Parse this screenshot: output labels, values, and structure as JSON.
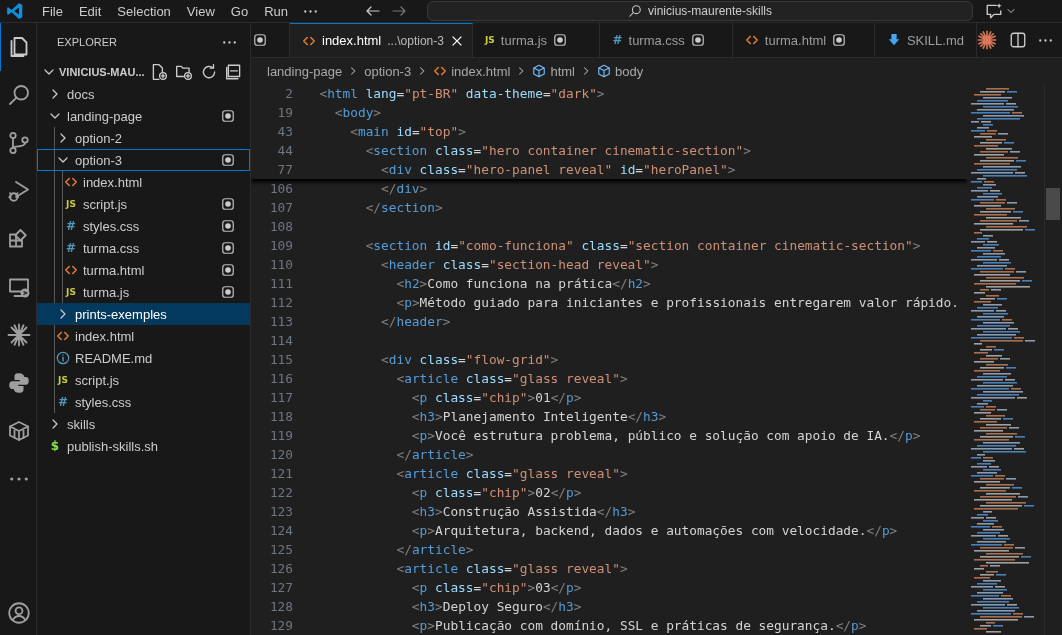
{
  "title_bar": {
    "menu": [
      "File",
      "Edit",
      "Selection",
      "View",
      "Go",
      "Run"
    ],
    "command_center": "vinicius-maurente-skills"
  },
  "activity_bar": [
    {
      "kind": "files",
      "selected": true
    },
    {
      "kind": "search",
      "selected": false
    },
    {
      "kind": "source-control",
      "selected": false
    },
    {
      "kind": "run-debug",
      "selected": false
    },
    {
      "kind": "extensions",
      "selected": false
    },
    {
      "kind": "remote",
      "selected": false
    },
    {
      "kind": "sparkle",
      "selected": false
    },
    {
      "kind": "python",
      "selected": false
    },
    {
      "kind": "containers",
      "selected": false
    },
    {
      "kind": "more",
      "selected": false
    },
    {
      "kind": "account",
      "selected": false
    }
  ],
  "sidebar": {
    "title": "EXPLORER",
    "root": "VINICIUS-MAU...",
    "items": [
      {
        "label": "docs",
        "kind": "folder",
        "expanded": false,
        "selected": false,
        "focused": false,
        "modified": false
      },
      {
        "label": "landing-page",
        "kind": "folder",
        "expanded": true,
        "selected": false,
        "focused": false,
        "modified": true,
        "children": [
          {
            "label": "option-2",
            "kind": "folder",
            "expanded": false,
            "selected": false,
            "focused": false,
            "modified": false
          },
          {
            "label": "option-3",
            "kind": "folder",
            "expanded": true,
            "selected": false,
            "focused": true,
            "modified": true,
            "children": [
              {
                "label": "index.html",
                "kind": "html",
                "selected": false,
                "focused": false,
                "modified": false
              },
              {
                "label": "script.js",
                "kind": "js",
                "badge": "JS",
                "selected": false,
                "focused": false,
                "modified": true
              },
              {
                "label": "styles.css",
                "kind": "css",
                "badge": "#",
                "selected": false,
                "focused": false,
                "modified": true
              },
              {
                "label": "turma.css",
                "kind": "css",
                "badge": "#",
                "selected": false,
                "focused": false,
                "modified": true
              },
              {
                "label": "turma.html",
                "kind": "html",
                "selected": false,
                "focused": false,
                "modified": true
              },
              {
                "label": "turma.js",
                "kind": "js",
                "badge": "JS",
                "selected": false,
                "focused": false,
                "modified": true
              }
            ]
          },
          {
            "label": "prints-exemples",
            "kind": "folder",
            "expanded": false,
            "selected": true,
            "focused": false,
            "modified": false
          },
          {
            "label": "index.html",
            "kind": "html",
            "selected": false,
            "focused": false,
            "modified": false
          },
          {
            "label": "README.md",
            "kind": "info",
            "selected": false,
            "focused": false,
            "modified": false
          },
          {
            "label": "script.js",
            "kind": "js",
            "badge": "JS",
            "selected": false,
            "focused": false,
            "modified": false
          },
          {
            "label": "styles.css",
            "kind": "css",
            "badge": "#",
            "selected": false,
            "focused": false,
            "modified": false
          }
        ]
      },
      {
        "label": "skills",
        "kind": "folder",
        "expanded": false,
        "selected": false,
        "focused": false,
        "modified": false
      },
      {
        "label": "publish-skills.sh",
        "kind": "sh",
        "badge": "$",
        "selected": false,
        "focused": false,
        "modified": false
      }
    ]
  },
  "tabs": [
    {
      "kind": "partial",
      "selected": false,
      "modified": true
    },
    {
      "label": "index.html",
      "description": "...\\option-3",
      "kind": "html",
      "selected": true,
      "modified": false
    },
    {
      "label": "turma.js",
      "kind": "js",
      "badge": "JS",
      "selected": false,
      "modified": true
    },
    {
      "label": "turma.css",
      "kind": "css",
      "badge": "#",
      "selected": false,
      "modified": true
    },
    {
      "label": "turma.html",
      "kind": "html",
      "selected": false,
      "modified": true
    },
    {
      "label": "SKILL.md",
      "kind": "md",
      "selected": false,
      "modified": false
    }
  ],
  "breadcrumb": [
    {
      "label": "landing-page",
      "kind": "folder"
    },
    {
      "label": "option-3",
      "kind": "folder"
    },
    {
      "label": "index.html",
      "kind": "html"
    },
    {
      "label": "html",
      "kind": "element"
    },
    {
      "label": "body",
      "kind": "element"
    }
  ],
  "sticky_lines": [
    {
      "number": "2",
      "segments": [
        {
          "kind": "punct",
          "text": "  <"
        },
        {
          "kind": "tag",
          "text": "html"
        },
        {
          "kind": "attr",
          "text": " lang"
        },
        {
          "kind": "plain",
          "text": "="
        },
        {
          "kind": "string",
          "text": "\"pt-BR\""
        },
        {
          "kind": "attr",
          "text": " data-theme"
        },
        {
          "kind": "plain",
          "text": "="
        },
        {
          "kind": "string",
          "text": "\"dark\""
        },
        {
          "kind": "punct",
          "text": ">"
        }
      ]
    },
    {
      "number": "19",
      "segments": [
        {
          "kind": "punct",
          "text": "    <"
        },
        {
          "kind": "tag",
          "text": "body"
        },
        {
          "kind": "punct",
          "text": ">"
        }
      ]
    },
    {
      "number": "43",
      "segments": [
        {
          "kind": "punct",
          "text": "      <"
        },
        {
          "kind": "tag",
          "text": "main"
        },
        {
          "kind": "attr",
          "text": " id"
        },
        {
          "kind": "plain",
          "text": "="
        },
        {
          "kind": "string",
          "text": "\"top\""
        },
        {
          "kind": "punct",
          "text": ">"
        }
      ]
    },
    {
      "number": "44",
      "segments": [
        {
          "kind": "punct",
          "text": "        <"
        },
        {
          "kind": "tag",
          "text": "section"
        },
        {
          "kind": "attr",
          "text": " class"
        },
        {
          "kind": "plain",
          "text": "="
        },
        {
          "kind": "string",
          "text": "\"hero container cinematic-section\""
        },
        {
          "kind": "punct",
          "text": ">"
        }
      ]
    },
    {
      "number": "77",
      "segments": [
        {
          "kind": "punct",
          "text": "          <"
        },
        {
          "kind": "tag",
          "text": "div"
        },
        {
          "kind": "attr",
          "text": " class"
        },
        {
          "kind": "plain",
          "text": "="
        },
        {
          "kind": "string",
          "text": "\"hero-panel reveal\""
        },
        {
          "kind": "attr",
          "text": " id"
        },
        {
          "kind": "plain",
          "text": "="
        },
        {
          "kind": "string",
          "text": "\"heroPanel\""
        },
        {
          "kind": "punct",
          "text": ">"
        }
      ]
    }
  ],
  "code_lines": [
    {
      "number": "106",
      "segments": [
        {
          "kind": "punct",
          "text": "          </"
        },
        {
          "kind": "tag",
          "text": "div"
        },
        {
          "kind": "punct",
          "text": ">"
        }
      ]
    },
    {
      "number": "107",
      "segments": [
        {
          "kind": "punct",
          "text": "        </"
        },
        {
          "kind": "tag",
          "text": "section"
        },
        {
          "kind": "punct",
          "text": ">"
        }
      ]
    },
    {
      "number": "108"
    },
    {
      "number": "109",
      "segments": [
        {
          "kind": "punct",
          "text": "        <"
        },
        {
          "kind": "tag",
          "text": "section"
        },
        {
          "kind": "attr",
          "text": " id"
        },
        {
          "kind": "plain",
          "text": "="
        },
        {
          "kind": "string",
          "text": "\"como-funciona\""
        },
        {
          "kind": "attr",
          "text": " class"
        },
        {
          "kind": "plain",
          "text": "="
        },
        {
          "kind": "string",
          "text": "\"section container cinematic-section\""
        },
        {
          "kind": "punct",
          "text": ">"
        }
      ]
    },
    {
      "number": "110",
      "segments": [
        {
          "kind": "punct",
          "text": "          <"
        },
        {
          "kind": "tag",
          "text": "header"
        },
        {
          "kind": "attr",
          "text": " class"
        },
        {
          "kind": "plain",
          "text": "="
        },
        {
          "kind": "string",
          "text": "\"section-head reveal\""
        },
        {
          "kind": "punct",
          "text": ">"
        }
      ]
    },
    {
      "number": "111",
      "segments": [
        {
          "kind": "punct",
          "text": "            <"
        },
        {
          "kind": "tag",
          "text": "h2"
        },
        {
          "kind": "punct",
          "text": ">"
        },
        {
          "kind": "plain",
          "text": "Como funciona na prática"
        },
        {
          "kind": "punct",
          "text": "</"
        },
        {
          "kind": "tag",
          "text": "h2"
        },
        {
          "kind": "punct",
          "text": ">"
        }
      ]
    },
    {
      "number": "112",
      "segments": [
        {
          "kind": "punct",
          "text": "            <"
        },
        {
          "kind": "tag",
          "text": "p"
        },
        {
          "kind": "punct",
          "text": ">"
        },
        {
          "kind": "plain",
          "text": "Método guiado para iniciantes e profissionais entregarem valor rápido."
        }
      ]
    },
    {
      "number": "113",
      "segments": [
        {
          "kind": "punct",
          "text": "          </"
        },
        {
          "kind": "tag",
          "text": "header"
        },
        {
          "kind": "punct",
          "text": ">"
        }
      ]
    },
    {
      "number": "114"
    },
    {
      "number": "115",
      "segments": [
        {
          "kind": "punct",
          "text": "          <"
        },
        {
          "kind": "tag",
          "text": "div"
        },
        {
          "kind": "attr",
          "text": " class"
        },
        {
          "kind": "plain",
          "text": "="
        },
        {
          "kind": "string",
          "text": "\"flow-grid\""
        },
        {
          "kind": "punct",
          "text": ">"
        }
      ]
    },
    {
      "number": "116",
      "segments": [
        {
          "kind": "punct",
          "text": "            <"
        },
        {
          "kind": "tag",
          "text": "article"
        },
        {
          "kind": "attr",
          "text": " class"
        },
        {
          "kind": "plain",
          "text": "="
        },
        {
          "kind": "string",
          "text": "\"glass reveal\""
        },
        {
          "kind": "punct",
          "text": ">"
        }
      ]
    },
    {
      "number": "117",
      "segments": [
        {
          "kind": "punct",
          "text": "              <"
        },
        {
          "kind": "tag",
          "text": "p"
        },
        {
          "kind": "attr",
          "text": " class"
        },
        {
          "kind": "plain",
          "text": "="
        },
        {
          "kind": "string",
          "text": "\"chip\""
        },
        {
          "kind": "punct",
          "text": ">"
        },
        {
          "kind": "plain",
          "text": "01"
        },
        {
          "kind": "punct",
          "text": "</"
        },
        {
          "kind": "tag",
          "text": "p"
        },
        {
          "kind": "punct",
          "text": ">"
        }
      ]
    },
    {
      "number": "118",
      "segments": [
        {
          "kind": "punct",
          "text": "              <"
        },
        {
          "kind": "tag",
          "text": "h3"
        },
        {
          "kind": "punct",
          "text": ">"
        },
        {
          "kind": "plain",
          "text": "Planejamento Inteligente"
        },
        {
          "kind": "punct",
          "text": "</"
        },
        {
          "kind": "tag",
          "text": "h3"
        },
        {
          "kind": "punct",
          "text": ">"
        }
      ]
    },
    {
      "number": "119",
      "segments": [
        {
          "kind": "punct",
          "text": "              <"
        },
        {
          "kind": "tag",
          "text": "p"
        },
        {
          "kind": "punct",
          "text": ">"
        },
        {
          "kind": "plain",
          "text": "Você estrutura problema, público e solução com apoio de IA."
        },
        {
          "kind": "punct",
          "text": "</"
        },
        {
          "kind": "tag",
          "text": "p"
        },
        {
          "kind": "punct",
          "text": ">"
        }
      ]
    },
    {
      "number": "120",
      "segments": [
        {
          "kind": "punct",
          "text": "            </"
        },
        {
          "kind": "tag",
          "text": "article"
        },
        {
          "kind": "punct",
          "text": ">"
        }
      ]
    },
    {
      "number": "121",
      "segments": [
        {
          "kind": "punct",
          "text": "            <"
        },
        {
          "kind": "tag",
          "text": "article"
        },
        {
          "kind": "attr",
          "text": " class"
        },
        {
          "kind": "plain",
          "text": "="
        },
        {
          "kind": "string",
          "text": "\"glass reveal\""
        },
        {
          "kind": "punct",
          "text": ">"
        }
      ]
    },
    {
      "number": "122",
      "segments": [
        {
          "kind": "punct",
          "text": "              <"
        },
        {
          "kind": "tag",
          "text": "p"
        },
        {
          "kind": "attr",
          "text": " class"
        },
        {
          "kind": "plain",
          "text": "="
        },
        {
          "kind": "string",
          "text": "\"chip\""
        },
        {
          "kind": "punct",
          "text": ">"
        },
        {
          "kind": "plain",
          "text": "02"
        },
        {
          "kind": "punct",
          "text": "</"
        },
        {
          "kind": "tag",
          "text": "p"
        },
        {
          "kind": "punct",
          "text": ">"
        }
      ]
    },
    {
      "number": "123",
      "segments": [
        {
          "kind": "punct",
          "text": "              <"
        },
        {
          "kind": "tag",
          "text": "h3"
        },
        {
          "kind": "punct",
          "text": ">"
        },
        {
          "kind": "plain",
          "text": "Construção Assistida"
        },
        {
          "kind": "punct",
          "text": "</"
        },
        {
          "kind": "tag",
          "text": "h3"
        },
        {
          "kind": "punct",
          "text": ">"
        }
      ]
    },
    {
      "number": "124",
      "segments": [
        {
          "kind": "punct",
          "text": "              <"
        },
        {
          "kind": "tag",
          "text": "p"
        },
        {
          "kind": "punct",
          "text": ">"
        },
        {
          "kind": "plain",
          "text": "Arquitetura, backend, dados e automações com velocidade."
        },
        {
          "kind": "punct",
          "text": "</"
        },
        {
          "kind": "tag",
          "text": "p"
        },
        {
          "kind": "punct",
          "text": ">"
        }
      ]
    },
    {
      "number": "125",
      "segments": [
        {
          "kind": "punct",
          "text": "            </"
        },
        {
          "kind": "tag",
          "text": "article"
        },
        {
          "kind": "punct",
          "text": ">"
        }
      ]
    },
    {
      "number": "126",
      "segments": [
        {
          "kind": "punct",
          "text": "            <"
        },
        {
          "kind": "tag",
          "text": "article"
        },
        {
          "kind": "attr",
          "text": " class"
        },
        {
          "kind": "plain",
          "text": "="
        },
        {
          "kind": "string",
          "text": "\"glass reveal\""
        },
        {
          "kind": "punct",
          "text": ">"
        }
      ]
    },
    {
      "number": "127",
      "segments": [
        {
          "kind": "punct",
          "text": "              <"
        },
        {
          "kind": "tag",
          "text": "p"
        },
        {
          "kind": "attr",
          "text": " class"
        },
        {
          "kind": "plain",
          "text": "="
        },
        {
          "kind": "string",
          "text": "\"chip\""
        },
        {
          "kind": "punct",
          "text": ">"
        },
        {
          "kind": "plain",
          "text": "03"
        },
        {
          "kind": "punct",
          "text": "</"
        },
        {
          "kind": "tag",
          "text": "p"
        },
        {
          "kind": "punct",
          "text": ">"
        }
      ]
    },
    {
      "number": "128",
      "segments": [
        {
          "kind": "punct",
          "text": "              <"
        },
        {
          "kind": "tag",
          "text": "h3"
        },
        {
          "kind": "punct",
          "text": ">"
        },
        {
          "kind": "plain",
          "text": "Deploy Seguro"
        },
        {
          "kind": "punct",
          "text": "</"
        },
        {
          "kind": "tag",
          "text": "h3"
        },
        {
          "kind": "punct",
          "text": ">"
        }
      ]
    },
    {
      "number": "129",
      "segments": [
        {
          "kind": "punct",
          "text": "              <"
        },
        {
          "kind": "tag",
          "text": "p"
        },
        {
          "kind": "punct",
          "text": ">"
        },
        {
          "kind": "plain",
          "text": "Publicação com domínio, SSL e práticas de segurança."
        },
        {
          "kind": "punct",
          "text": "</"
        },
        {
          "kind": "tag",
          "text": "p"
        },
        {
          "kind": "punct",
          "text": ">"
        }
      ]
    }
  ]
}
